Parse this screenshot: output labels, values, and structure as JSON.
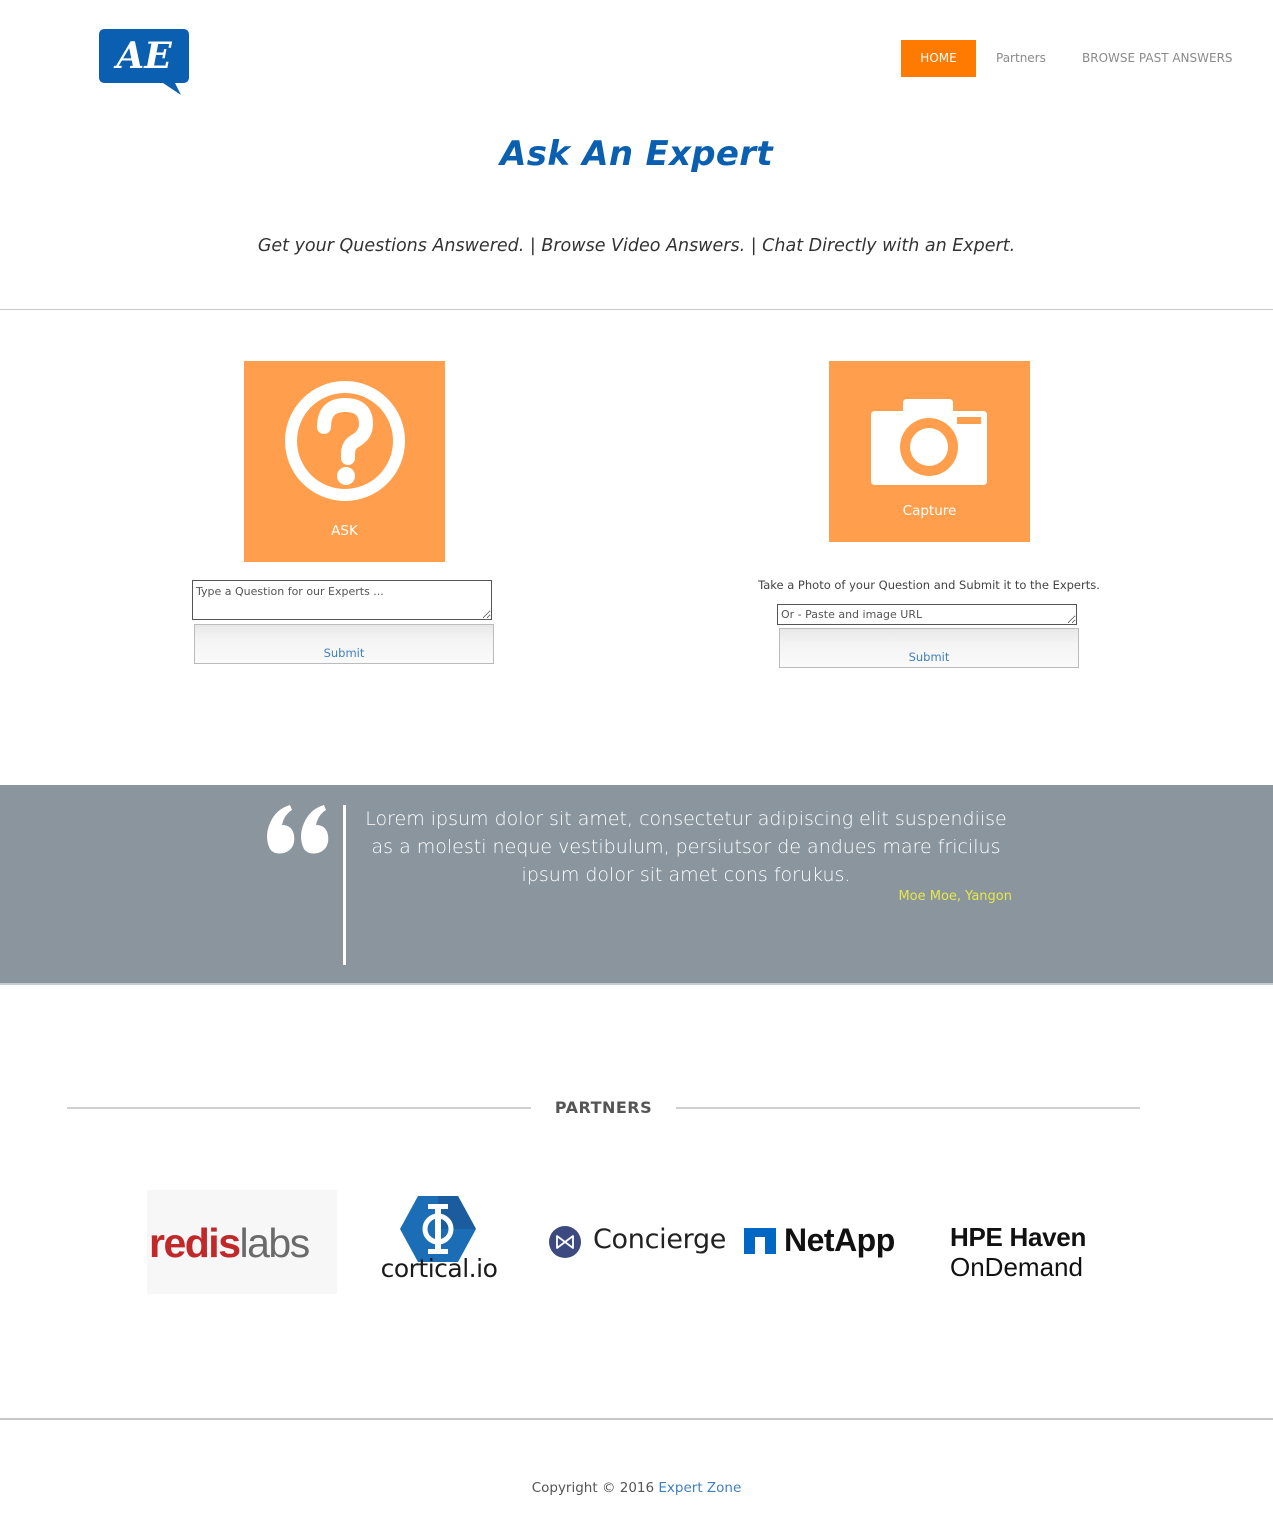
{
  "header": {
    "logo_text": "AE",
    "nav": {
      "home": "HOME",
      "partners": "Partners",
      "browse": "BROWSE PAST ANSWERS"
    }
  },
  "hero": {
    "title": "Ask An Expert",
    "subtitle": "Get your Questions Answered. | Browse Video Answers. | Chat Directly with an Expert."
  },
  "ask": {
    "tile_label": "ASK",
    "input_placeholder": "Type a Question for our Experts ...",
    "submit_label": "Submit"
  },
  "capture": {
    "tile_label": "Capture",
    "hint": "Take a Photo of your Question and Submit it to the Experts.",
    "input_placeholder": "Or - Paste and image URL",
    "submit_label": "Submit"
  },
  "testimonial": {
    "text": "Lorem ipsum dolor sit amet, consectetur adipiscing elit suspendiise as a molesti neque vestibulum, persiutsor de andues mare fricilus ipsum dolor sit amet cons forukus.",
    "author": "Moe Moe, Yangon"
  },
  "partners": {
    "title": "PARTNERS",
    "logos": {
      "redis_part1": "redis",
      "redis_part2": "labs",
      "cortical": "cortical.io",
      "concierge": "Concierge",
      "netapp": "NetApp",
      "hpe_line1": "HPE Haven",
      "hpe_line2": "OnDemand"
    }
  },
  "footer": {
    "copyright": "Copyright © 2016",
    "link": "Expert Zone"
  },
  "colors": {
    "brand_blue": "#0a5fb0",
    "accent_orange": "#ff7a00",
    "tile_orange": "#ff9f4d",
    "testimonial_bg": "#8a959e",
    "author_yellow": "#e6e84a"
  }
}
